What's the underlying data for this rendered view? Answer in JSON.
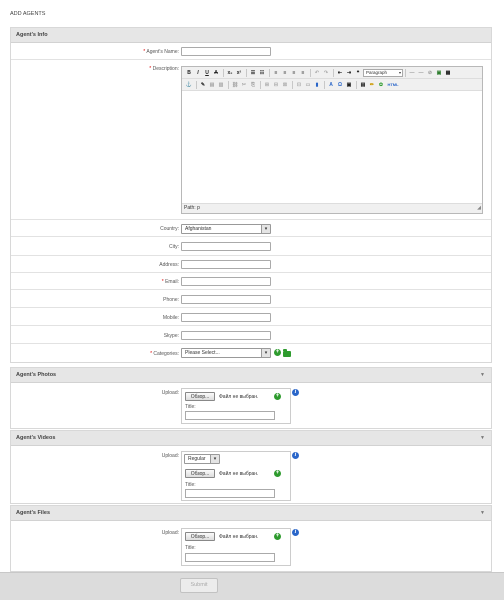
{
  "page_title": "ADD AGENTS",
  "agents_info": {
    "header": "Agent's Info",
    "fields": {
      "name_label": "Agent's Name:",
      "description_label": "Description:",
      "country_label": "Country:",
      "country_value": "Afghanistan",
      "city_label": "City:",
      "address_label": "Address:",
      "email_label": "Email:",
      "phone_label": "Phone:",
      "mobile_label": "Mobile:",
      "skype_label": "Skype:",
      "categories_label": "Categories:",
      "categories_value": "Please Select..."
    },
    "required_mark": "*",
    "editor": {
      "format_value": "Paragraph",
      "path_text": "Path: p",
      "html_label": "HTML"
    }
  },
  "photos": {
    "header": "Agent's Photos",
    "upload_label": "Upload:",
    "browse_label": "Обзор...",
    "no_file_text": "Файл не выбран.",
    "title_label": "Title:"
  },
  "videos": {
    "header": "Agent's Videos",
    "upload_label": "Upload:",
    "type_value": "Regular",
    "browse_label": "Обзор...",
    "no_file_text": "Файл не выбран.",
    "title_label": "Title:"
  },
  "files": {
    "header": "Agent's Files",
    "upload_label": "Upload:",
    "browse_label": "Обзор...",
    "no_file_text": "Файл не выбран.",
    "title_label": "Title:"
  },
  "submit_label": "Submit",
  "colors": {
    "header_bg": "#e6e6e6",
    "required": "#dd0000",
    "add_green": "#2e9b2e",
    "info_blue": "#2a66c9"
  }
}
